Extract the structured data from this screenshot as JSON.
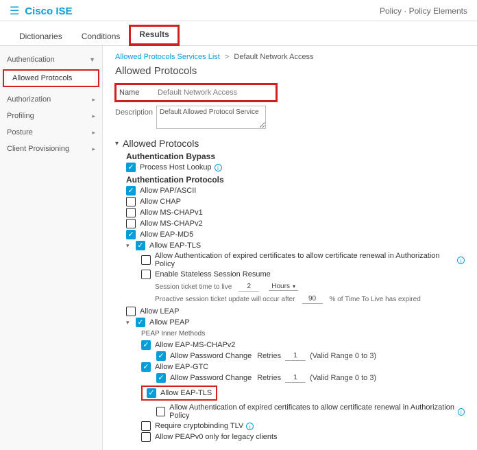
{
  "header": {
    "brand": "Cisco ISE",
    "path": "Policy · Policy Elements"
  },
  "tabs": {
    "dictionaries": "Dictionaries",
    "conditions": "Conditions",
    "results": "Results"
  },
  "sidebar": {
    "authentication": "Authentication",
    "allowed_protocols": "Allowed Protocols",
    "authorization": "Authorization",
    "profiling": "Profiling",
    "posture": "Posture",
    "client_provisioning": "Client Provisioning"
  },
  "breadcrumb": {
    "parent": "Allowed Protocols Services List",
    "current": "Default Network Access"
  },
  "page_title": "Allowed Protocols",
  "fields": {
    "name_label": "Name",
    "name_value": "Default Network Access",
    "desc_label": "Description",
    "desc_value": "Default Allowed Protocol Service"
  },
  "section": {
    "allowed_protocols": "Allowed Protocols"
  },
  "subheads": {
    "bypass": "Authentication Bypass",
    "authproto": "Authentication Protocols",
    "peap_inner": "PEAP Inner Methods"
  },
  "checks": {
    "process_host_lookup": "Process Host Lookup",
    "allow_pap": "Allow PAP/ASCII",
    "allow_chap": "Allow CHAP",
    "allow_mschapv1": "Allow MS-CHAPv1",
    "allow_mschapv2": "Allow MS-CHAPv2",
    "allow_eapmd5": "Allow EAP-MD5",
    "allow_eaptls": "Allow EAP-TLS",
    "expired_cert_renew": "Allow Authentication of expired certificates to allow certificate renewal in Authorization Policy",
    "stateless_resume": "Enable Stateless Session Resume",
    "allow_leap": "Allow LEAP",
    "allow_peap": "Allow PEAP",
    "peap_mschapv2": "Allow EAP-MS-CHAPv2",
    "allow_password_change": "Allow Password Change",
    "eap_gtc": "Allow EAP-GTC",
    "inner_eap_tls": "Allow EAP-TLS",
    "expired_cert_renew2": "Allow Authentication of expired certificates to allow certificate renewal in Authorization Policy",
    "require_cryptobinding": "Require cryptobinding TLV",
    "peapv0_legacy": "Allow PEAPv0 only for legacy clients"
  },
  "ticket": {
    "label": "Session ticket time to live",
    "value": "2",
    "unit": "Hours",
    "proactive_pre": "Proactive session ticket update will occur after",
    "proactive_val": "90",
    "proactive_post": "% of Time To Live has expired"
  },
  "retries": {
    "label": "Retries",
    "value1": "1",
    "value2": "1",
    "range": "(Valid Range 0 to 3)"
  }
}
